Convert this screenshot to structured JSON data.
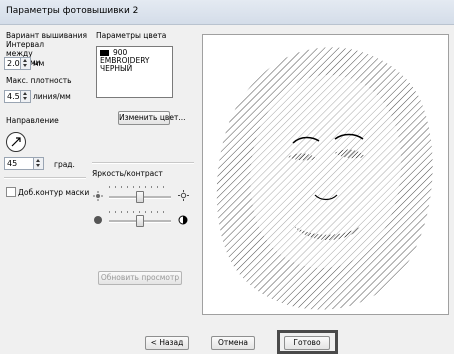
{
  "window": {
    "title": "Параметры фотовышивки 2"
  },
  "left": {
    "stitch_type_label": "Вариант вышивания",
    "interval_label": "Интервал между линиями",
    "interval_value": "2.0",
    "interval_unit": "мм",
    "density_label": "Макс. плотность",
    "density_value": "4.5",
    "density_unit": "линия/мм",
    "direction_label": "Направление",
    "angle_value": "45",
    "angle_unit": "град.",
    "mask_label": "Доб.контур маски"
  },
  "color": {
    "group_label": "Параметры цвета",
    "items": [
      "900",
      "EMBROIDERY",
      "ЧЕРНЫЙ"
    ],
    "swatch": "#000000",
    "change_button": "Изменить цвет..."
  },
  "brightness": {
    "label": "Яркость/контраст",
    "brightness_level": 0.5,
    "contrast_level": 0.5
  },
  "update_button": "Обновить просмотр",
  "footer": {
    "back": "< Назад",
    "cancel": "Отмена",
    "done": "Готово"
  }
}
